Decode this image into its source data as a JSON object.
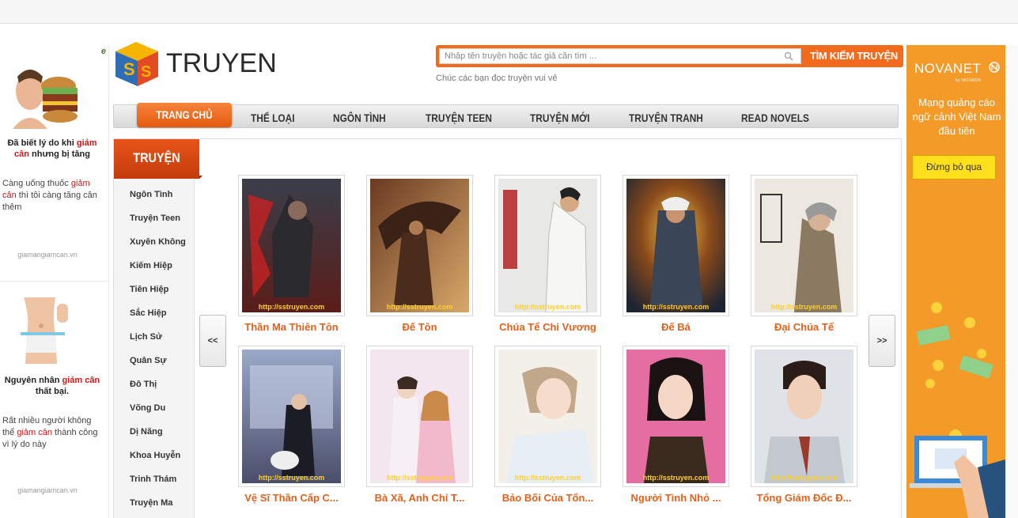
{
  "ad_left": {
    "adchoices_glyph": "e",
    "blocks": [
      {
        "title_pre": "Đã biết lý do khi ",
        "title_red": "giảm cân",
        "title_post": " nhưng bị tăng",
        "desc_pre": "Càng uống thuốc ",
        "desc_red": "giảm cân",
        "desc_post": " thì tôi càng tăng cân thêm",
        "source": "giamangiamcan.vn"
      },
      {
        "title_pre": "Nguyên nhân ",
        "title_red": "giảm cân",
        "title_post": " thất bại.",
        "desc_pre": "Rất nhiều người không thể ",
        "desc_red": "giảm cân",
        "desc_post": " thành công vì lý do này",
        "source": "giamangiamcan.vn"
      }
    ]
  },
  "logo": {
    "text": "TRUYEN"
  },
  "search": {
    "placeholder": "Nhập tên truyện hoặc tác giả cần tìm ...",
    "button": "TÌM KIẾM TRUYỆN",
    "slogan": "Chúc các bạn đọc truyện vui vẻ"
  },
  "nav": {
    "items": [
      "TRANG CHỦ",
      "THỂ LOẠI",
      "NGÔN TÌNH",
      "TRUYỆN TEEN",
      "TRUYỆN MỚI",
      "TRUYỆN TRANH",
      "READ NOVELS"
    ],
    "active": "TRANG CHỦ"
  },
  "sidebar": {
    "header": "TRUYỆN TOP",
    "items": [
      "Ngôn Tình",
      "Truyện Teen",
      "Xuyên Không",
      "Kiếm Hiệp",
      "Tiên Hiệp",
      "Sắc Hiệp",
      "Lịch Sử",
      "Quân Sự",
      "Đô Thị",
      "Võng Du",
      "Dị Năng",
      "Khoa Huyễn",
      "Trinh Thám",
      "Truyện Ma"
    ]
  },
  "carousel": {
    "prev": "<<",
    "next": ">>",
    "watermark": "http://sstruyen.com",
    "books": [
      {
        "title": "Thần Ma Thiên Tôn"
      },
      {
        "title": "Đế Tôn"
      },
      {
        "title": "Chúa Tể Chi Vương"
      },
      {
        "title": "Đế Bá"
      },
      {
        "title": "Đại Chúa Tể"
      },
      {
        "title": "Vệ Sĩ Thần Cấp C..."
      },
      {
        "title": "Bà Xã, Anh Chỉ T..."
      },
      {
        "title": "Bảo Bối Của Tổn..."
      },
      {
        "title": "Người Tình Nhỏ ..."
      },
      {
        "title": "Tổng Giám Đốc Đ..."
      }
    ]
  },
  "ad_right": {
    "brand": "NOVANET",
    "brand_sub": "by NOVAON",
    "tagline": "Mạng quảng cáo ngữ cảnh Việt Nam đầu tiên",
    "cta": "Đừng bỏ qua"
  },
  "colors": {
    "accent": "#f26b1d",
    "title_orange": "#e4611c",
    "ad_orange": "#f39a28",
    "ad_red": "#d41515"
  }
}
